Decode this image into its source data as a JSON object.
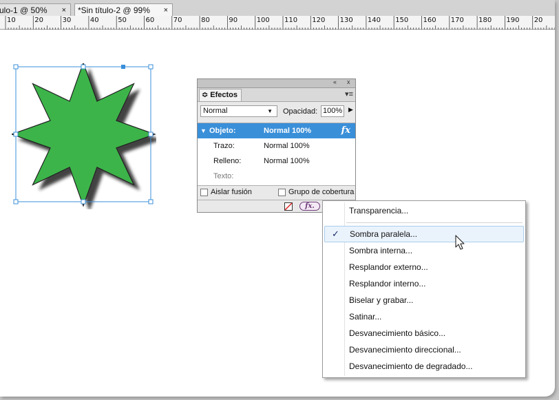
{
  "tabs": [
    {
      "label": "ulo-1 @ 50%",
      "close": "×"
    },
    {
      "label": "*Sin título-2 @ 99%",
      "close": "×"
    }
  ],
  "ruler": {
    "labels": [
      "10",
      "20",
      "30",
      "40",
      "50",
      "60",
      "70",
      "80",
      "90",
      "100",
      "110",
      "120",
      "130",
      "140",
      "150",
      "160",
      "170",
      "180",
      "190",
      "20"
    ]
  },
  "canvas": {
    "star_fill": "#3cb449",
    "selection_color": "#3a8fd9"
  },
  "effects_panel": {
    "panel_controls": "«  x",
    "tab_label": "Efectos",
    "tab_prefix": "≎",
    "menu_icon": "▾≡",
    "blend_mode": "Normal",
    "opacity_label": "Opacidad:",
    "opacity_value": "100%",
    "rows": [
      {
        "name": "Objeto:",
        "value": "Normal 100%",
        "selected": true,
        "fx": "fx"
      },
      {
        "name": "Trazo:",
        "value": "Normal 100%"
      },
      {
        "name": "Relleno:",
        "value": "Normal 100%"
      },
      {
        "name": "Texto:",
        "value": ""
      }
    ],
    "isolate_label": "Aislar fusión",
    "knockout_label": "Grupo de cobertura",
    "fx_button": "fx."
  },
  "fx_menu": {
    "items": [
      {
        "label": "Transparencia..."
      },
      {
        "label": "Sombra paralela...",
        "checked": true,
        "highlighted": true
      },
      {
        "label": "Sombra interna..."
      },
      {
        "label": "Resplandor externo..."
      },
      {
        "label": "Resplandor interno..."
      },
      {
        "label": "Biselar y grabar..."
      },
      {
        "label": "Satinar..."
      },
      {
        "label": "Desvanecimiento básico..."
      },
      {
        "label": "Desvanecimiento direccional..."
      },
      {
        "label": "Desvanecimiento de degradado..."
      }
    ],
    "check_glyph": "✓"
  }
}
